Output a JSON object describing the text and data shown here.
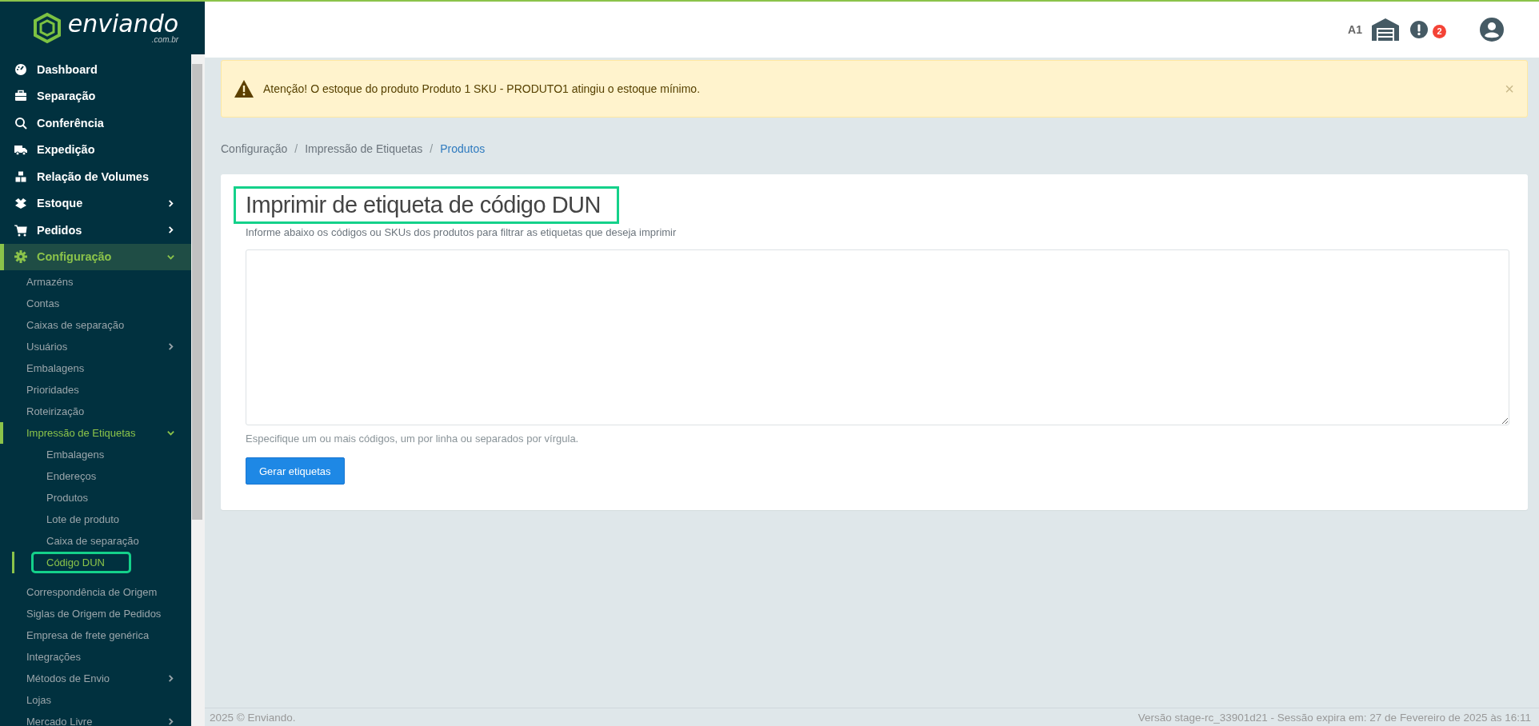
{
  "logo": {
    "name": "enviando",
    "domain": ".com.br"
  },
  "sidebar": {
    "items": [
      {
        "label": "Dashboard",
        "selected": false
      },
      {
        "label": "Separação",
        "selected": false
      },
      {
        "label": "Conferência",
        "selected": false
      },
      {
        "label": "Expedição",
        "selected": false
      },
      {
        "label": "Relação de Volumes",
        "selected": false
      },
      {
        "label": "Estoque",
        "selected": false,
        "expanded": false
      },
      {
        "label": "Pedidos",
        "selected": false,
        "expanded": false
      },
      {
        "label": "Configuração",
        "selected": true,
        "expanded": true,
        "children": [
          {
            "label": "Armazéns",
            "selected": false
          },
          {
            "label": "Contas",
            "selected": false
          },
          {
            "label": "Caixas de separação",
            "selected": false
          },
          {
            "label": "Usuários",
            "selected": false,
            "expanded": false
          },
          {
            "label": "Embalagens",
            "selected": false
          },
          {
            "label": "Prioridades",
            "selected": false
          },
          {
            "label": "Roteirização",
            "selected": false
          },
          {
            "label": "Impressão de Etiquetas",
            "selected": true,
            "expanded": true,
            "children": [
              {
                "label": "Embalagens",
                "selected": false
              },
              {
                "label": "Endereços",
                "selected": false
              },
              {
                "label": "Produtos",
                "selected": false
              },
              {
                "label": "Lote de produto",
                "selected": false
              },
              {
                "label": "Caixa de separação",
                "selected": false
              },
              {
                "label": "Código DUN",
                "selected": true,
                "highlighted": true
              }
            ]
          },
          {
            "label": "Correspondência de Origem",
            "selected": false
          },
          {
            "label": "Siglas de Origem de Pedidos",
            "selected": false
          },
          {
            "label": "Empresa de frete genérica",
            "selected": false
          },
          {
            "label": "Integrações",
            "selected": false
          },
          {
            "label": "Métodos de Envio",
            "selected": false,
            "expanded": false
          },
          {
            "label": "Lojas",
            "selected": false
          },
          {
            "label": "Mercado Livre",
            "selected": false,
            "expanded": false
          }
        ]
      }
    ]
  },
  "header": {
    "warehouse": "A1",
    "alert_count": "2"
  },
  "alert": {
    "message": "Atenção! O estoque do produto Produto 1 SKU - PRODUTO1 atingiu o estoque mínimo.",
    "close": "×"
  },
  "breadcrumb_separator": "/",
  "breadcrumb": [
    {
      "label": "Configuração",
      "current": false
    },
    {
      "label": "Impressão de Etiquetas",
      "current": false
    },
    {
      "label": "Produtos",
      "current": true
    }
  ],
  "card": {
    "title": "Imprimir de etiqueta de código DUN",
    "title_highlighted": true,
    "description": "Informe abaixo os códigos ou SKUs dos produtos para filtrar as etiquetas que deseja imprimir",
    "help": "Especifique um ou mais códigos, um por linha ou separados por vírgula.",
    "button": "Gerar etiquetas"
  },
  "footer": {
    "copyright": "2025 © Enviando.",
    "version": "Versão stage-rc_33901d21 - Sessão expira em: 27 de Fevereiro de 2025 às 16:11"
  }
}
